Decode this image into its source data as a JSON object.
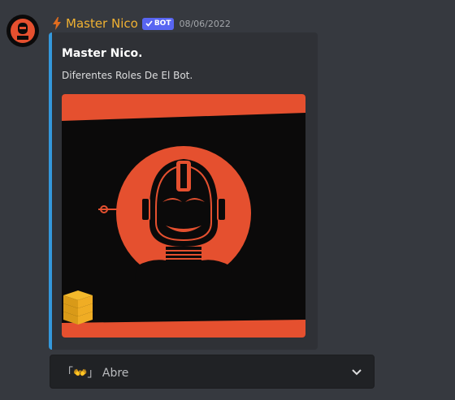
{
  "message": {
    "author": "Master Nico",
    "bot_tag": "BOT",
    "timestamp": "08/06/2022",
    "author_color": "#f0b132"
  },
  "embed": {
    "title": "Master Nico.",
    "description": "Diferentes Roles De El Bot.",
    "accent_color": "#3498db",
    "image": {
      "description_icon": "robot-head-logo",
      "colors": {
        "background": "#0b0a0a",
        "accent": "#e5502f"
      }
    }
  },
  "select_menu": {
    "label": "「👐」 Abre",
    "icon": "chevron-down-icon"
  }
}
